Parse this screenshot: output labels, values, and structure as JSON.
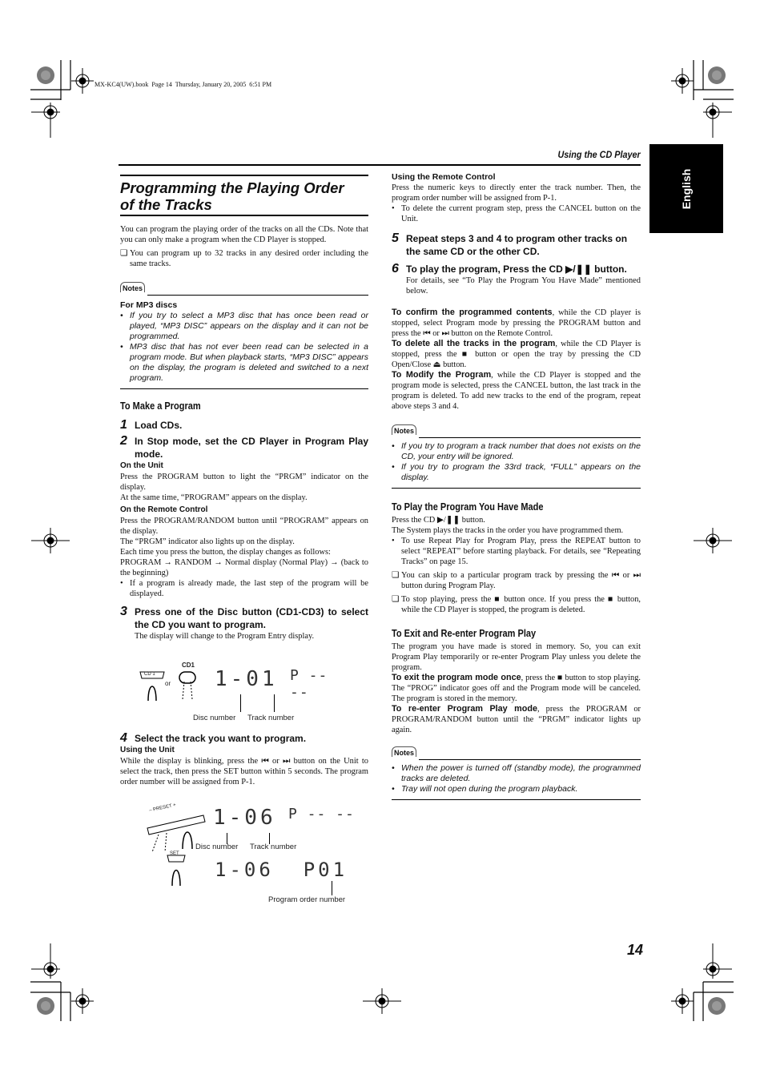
{
  "print_header": "MX-KC4(UW).book  Page 14  Thursday, January 20, 2005  6:51 PM",
  "running_head": "Using the CD Player",
  "language_tab": "English",
  "page_number": "14",
  "title": {
    "line1": "Programming the Playing Order",
    "line2": "of the Tracks"
  },
  "intro": "You can program the playing order of the tracks on all the CDs. Note that you can only make a program when the CD Player is stopped.",
  "intro_tip": "You can program up to 32 tracks in any desired order including the same tracks.",
  "notes_label": "Notes",
  "notes1": {
    "heading": "For MP3 discs",
    "items": [
      "If you try to select a MP3 disc that has once been read or played, “MP3 DISC” appears on the display and it can not be programmed.",
      "MP3 disc that has not ever been read can be selected in a program mode. But when playback starts, “MP3 DISC” appears on the display, the program is deleted and switched to a next program."
    ]
  },
  "make_program": {
    "heading": "To Make a Program",
    "step1": {
      "num": "1",
      "text": "Load CDs."
    },
    "step2": {
      "num": "2",
      "text": "In Stop mode, set the CD Player in Program Play mode.",
      "unit_label": "On the Unit",
      "unit_text1": "Press the PROGRAM button to light the “PRGM” indicator on the display.",
      "unit_text2": "At the same time, “PROGRAM” appears on the display.",
      "remote_label": "On the Remote Control",
      "remote_text1": "Press the PROGRAM/RANDOM button until “PROGRAM” appears on the display.",
      "remote_text2": "The “PRGM” indicator also lights up on the display.",
      "remote_text3": "Each time you press the button, the display changes as follows:",
      "remote_text4": "PROGRAM → RANDOM → Normal display (Normal Play) → (back to the beginning)",
      "remote_bullet": "If a program is already made, the last step of the program will be displayed."
    },
    "step3": {
      "num": "3",
      "text": "Press one of the Disc button (CD1-CD3) to select the CD you want to program.",
      "sub": "The display will change to the Program Entry display."
    },
    "fig1": {
      "btn1": "CD 1",
      "or": "or",
      "btn2": "CD1",
      "display_main": "1-01",
      "display_p": "P -- --",
      "cap_disc": "Disc number",
      "cap_track": "Track number"
    },
    "step4": {
      "num": "4",
      "text": "Select the track you want to program.",
      "unit_label": "Using the Unit",
      "unit_text": "While the display is blinking, press the ⏮ or ⏭ button on the Unit to select the track, then press the SET button within 5 seconds. The program order number will be assigned from P-1."
    },
    "fig2": {
      "preset": "– PRESET +",
      "display_main": "1-06",
      "display_p": "P -- --",
      "cap_disc": "Disc number",
      "cap_track": "Track number",
      "set": "SET",
      "display2": "1-06  P01",
      "cap_order": "Program order number"
    }
  },
  "remote": {
    "label": "Using the Remote Control",
    "text": "Press the numeric keys to directly enter the track number. Then, the program order number will be assigned from P-1.",
    "bullet": "To delete the current program step, press the CANCEL button on the Unit."
  },
  "step5": {
    "num": "5",
    "text": "Repeat steps 3 and 4 to program other tracks on the same CD or the other CD."
  },
  "step6": {
    "num": "6",
    "text": "To play the program, Press the CD ▶/❚❚ button.",
    "sub": "For details, see “To Play the Program You Have Made” mentioned below."
  },
  "confirm": {
    "bold": "To confirm the programmed contents",
    "text": ", while the CD player is stopped, select Program mode by pressing the PROGRAM button and press the ⏮ or ⏭ button on the Remote Control."
  },
  "delete_all": {
    "bold": "To delete all the tracks in the program",
    "text": ", while the CD Player is stopped, press the ■ button or open the tray by pressing the CD Open/Close ⏏ button."
  },
  "modify": {
    "bold": "To Modify the Program",
    "text": ", while the CD Player is stopped and the program mode is selected, press the CANCEL button, the last track in the program is deleted. To add new tracks to the end of the program, repeat above steps 3 and 4."
  },
  "notes2": [
    "If you try to program a track number that does not exists on the CD, your entry will be ignored.",
    "If you try to program the 33rd track, “FULL” appears on the display."
  ],
  "play_program": {
    "heading": "To Play the Program You Have Made",
    "text1": "Press the CD ▶/❚❚ button.",
    "text2": "The System plays the tracks in the order you have programmed them.",
    "bullet": "To use Repeat Play for Program Play, press the REPEAT button to select “REPEAT” before starting playback. For details, see “Repeating Tracks” on page 15.",
    "tip1": "You can skip to a particular program track by pressing the ⏮ or ⏭ button during Program Play.",
    "tip2": "To stop playing, press the ■ button once. If you press the ■ button, while the CD Player is stopped, the program is deleted."
  },
  "exit_program": {
    "heading": "To Exit and Re-enter Program Play",
    "text": "The program you have made is stored in memory. So, you can exit Program Play temporarily or re-enter Program Play unless you delete the program.",
    "exit_bold": "To exit the program mode once",
    "exit_text": ", press the ■ button to stop playing. The “PROG” indicator goes off and the Program mode will be canceled. The program is stored in the memory.",
    "reenter_bold": "To re-enter Program Play mode",
    "reenter_text": ", press the PROGRAM or PROGRAM/RANDOM button until the “PRGM” indicator lights up again."
  },
  "notes3": [
    "When the power is turned off (standby mode), the programmed tracks are deleted.",
    "Tray will not open during the program playback."
  ],
  "icons": {
    "tip_box": "❏",
    "bullet": "•",
    "note_bullet": "•"
  }
}
